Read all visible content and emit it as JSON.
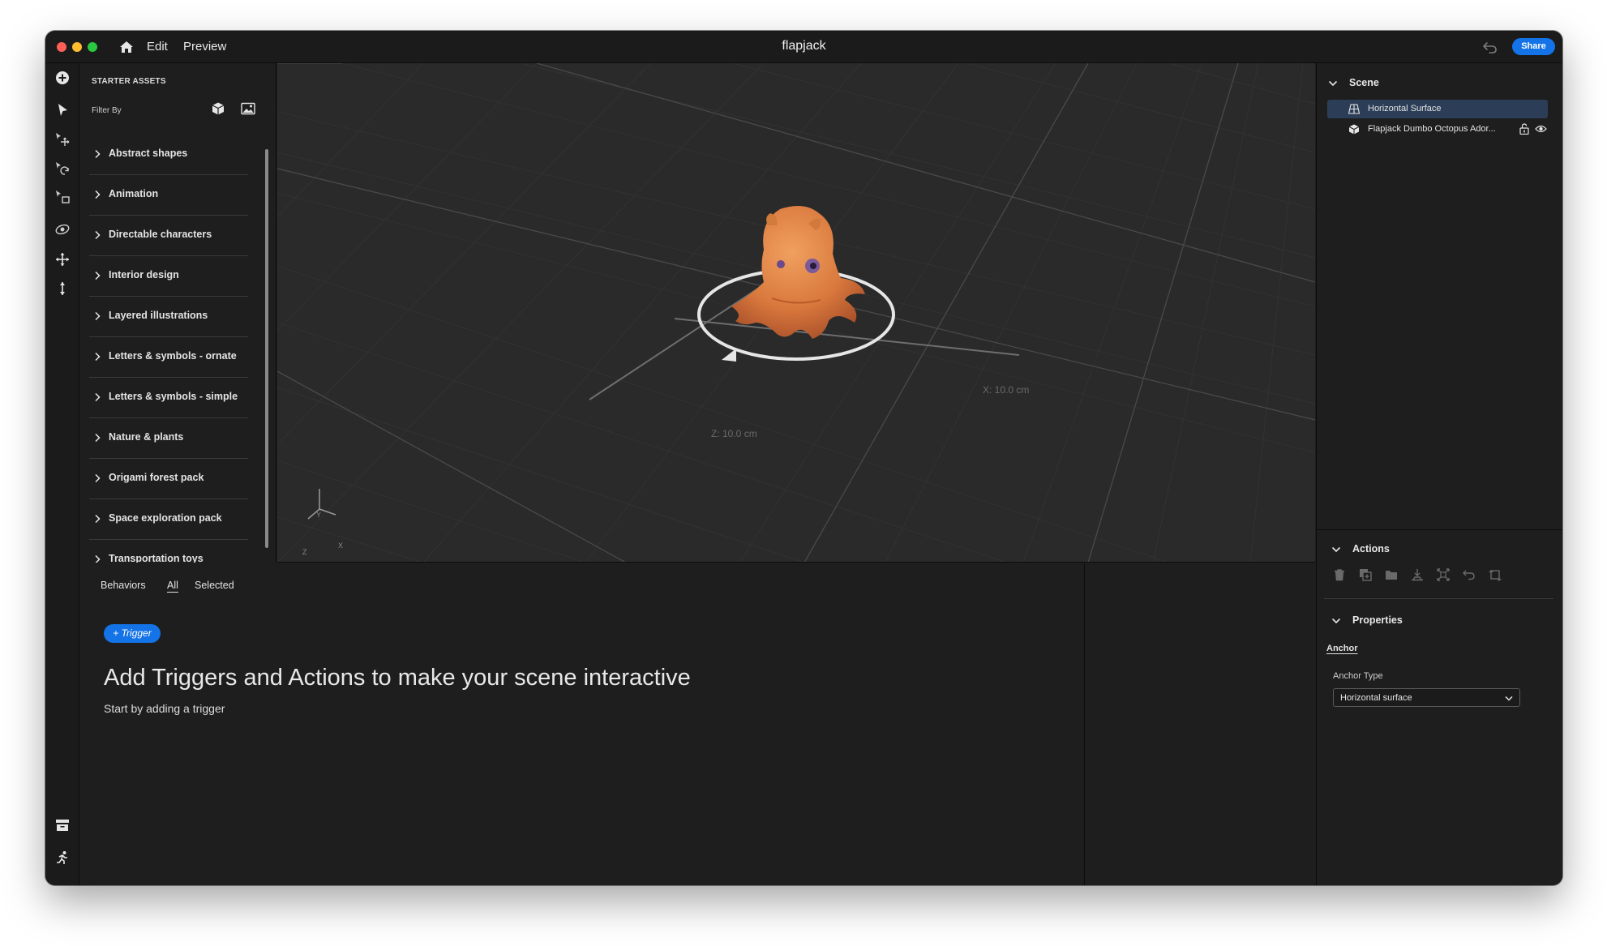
{
  "window": {
    "title": "flapjack",
    "menu": {
      "edit": "Edit",
      "preview": "Preview"
    },
    "share_label": "Share"
  },
  "toolbar": {
    "icons": [
      "add-icon",
      "select-arrow-icon",
      "move-tool-icon",
      "rotate-tool-icon",
      "scale-tool-icon",
      "orbit-camera-icon",
      "pan-camera-icon",
      "dolly-camera-icon",
      "assets-drawer-icon",
      "behaviors-run-icon"
    ]
  },
  "assets": {
    "title": "STARTER ASSETS",
    "filter_label": "Filter By",
    "categories": [
      "Abstract shapes",
      "Animation",
      "Directable characters",
      "Interior design",
      "Layered illustrations",
      "Letters & symbols - ornate",
      "Letters & symbols - simple",
      "Nature & plants",
      "Origami forest pack",
      "Space exploration pack",
      "Transportation toys"
    ]
  },
  "viewport": {
    "x_dimension": "X: 10.0 cm",
    "z_dimension": "Z: 10.0 cm",
    "axis_y": "Y",
    "axis_x": "X",
    "axis_z": "Z"
  },
  "behaviors": {
    "tab_behaviors": "Behaviors",
    "tab_all": "All",
    "tab_selected": "Selected",
    "trigger_label": "+ Trigger",
    "heading": "Add Triggers and Actions to make your scene interactive",
    "subheading": "Start by adding a trigger"
  },
  "scene": {
    "title": "Scene",
    "items": [
      {
        "label": "Horizontal Surface",
        "icon": "surface-icon",
        "selected": true
      },
      {
        "label": "Flapjack Dumbo Octopus Ador...",
        "icon": "3d-object-icon",
        "selected": false
      }
    ]
  },
  "actions": {
    "title": "Actions",
    "icons": [
      "delete-icon",
      "duplicate-icon",
      "group-icon",
      "drop-to-ground-icon",
      "fit-icon",
      "reset-icon",
      "replace-icon"
    ]
  },
  "properties": {
    "title": "Properties",
    "tab": "Anchor",
    "anchor_type_label": "Anchor Type",
    "anchor_type_value": "Horizontal surface"
  },
  "colors": {
    "accent": "#1473e6",
    "selected_row": "#2c3e57",
    "octopus": "#e0884a"
  }
}
